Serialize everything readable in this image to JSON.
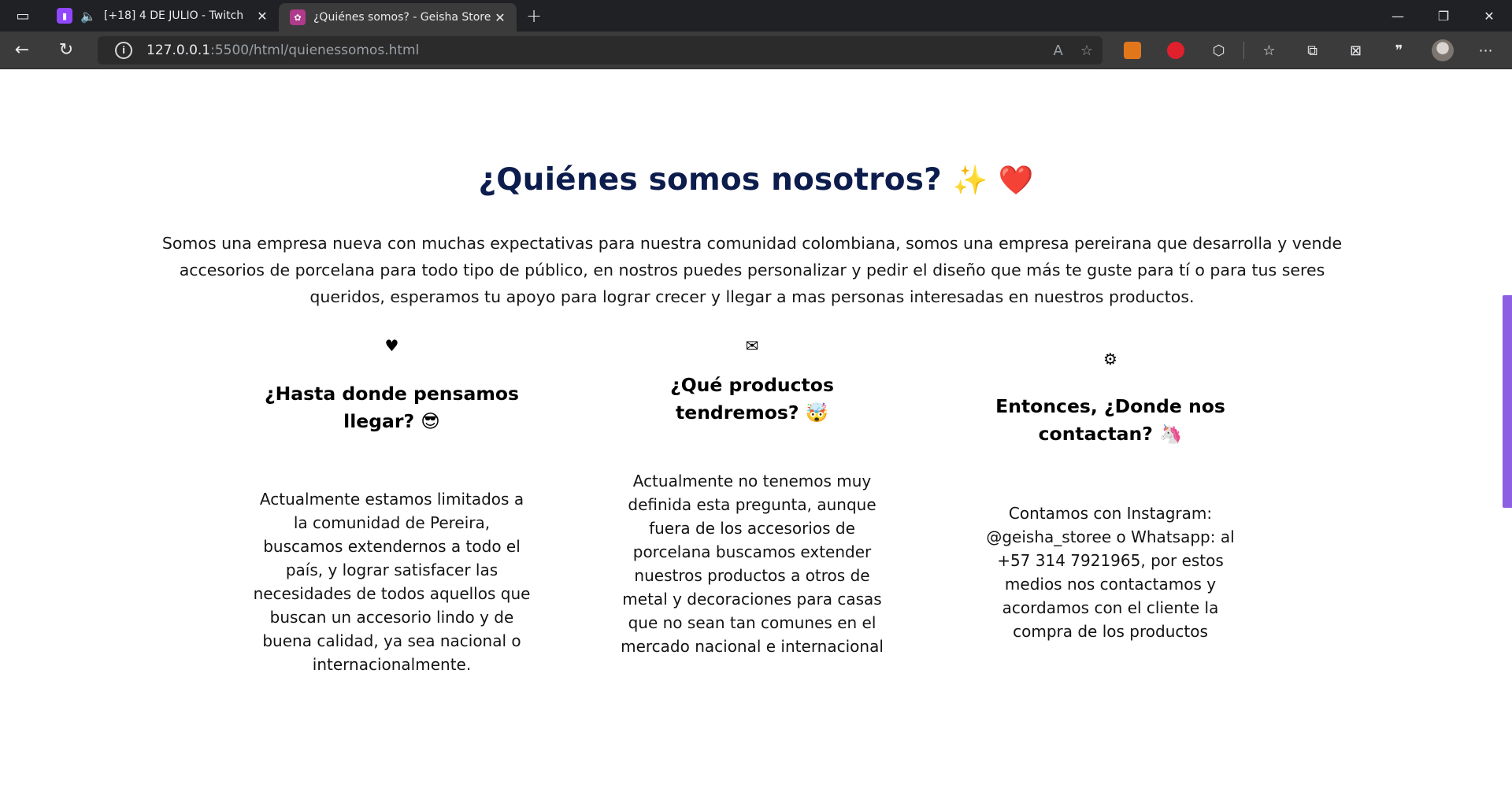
{
  "browser": {
    "tabs": [
      {
        "title": "[+18] 4 DE JULIO - Twitch",
        "active": false,
        "favicon": "twitch-icon",
        "audio": true
      },
      {
        "title": "¿Quiénes somos? - Geisha Store",
        "active": true,
        "favicon": "geisha-icon",
        "audio": false
      }
    ],
    "url_host": "127.0.0.1",
    "url_path": ":5500/html/quienessomos.html"
  },
  "page": {
    "heading": "¿Quiénes somos nosotros?",
    "heading_emojis": "✨ ❤️",
    "intro": "Somos una empresa nueva con muchas expectativas para nuestra comunidad colombiana, somos una empresa pereirana que desarrolla y vende accesorios de porcelana para todo tipo de público, en nostros puedes personalizar y pedir el diseño que más te guste para tí o para tus seres queridos, esperamos tu apoyo para lograr crecer y llegar a mas personas interesadas en nuestros productos.",
    "columns": [
      {
        "icon": "heart-icon",
        "icon_glyph": "♥",
        "title": "¿Hasta donde pensamos llegar? 😎",
        "text": "Actualmente estamos limitados a la comunidad de Pereira, buscamos extendernos a todo el país, y lograr satisfacer las necesidades de todos aquellos que buscan un accesorio lindo y de buena calidad, ya sea nacional o internacionalmente."
      },
      {
        "icon": "envelope-icon",
        "icon_glyph": "✉",
        "title": "¿Qué productos tendremos? 🤯",
        "text": "Actualmente no tenemos muy definida esta pregunta, aunque fuera de los accesorios de porcelana buscamos extender nuestros productos a otros de metal y decoraciones para casas que no sean tan comunes en el mercado nacional e internacional"
      },
      {
        "icon": "gear-icon",
        "icon_glyph": "⚙",
        "title": "Entonces, ¿Donde nos contactan? 🦄",
        "text": "Contamos con Instagram: @geisha_storee o Whatsapp: al +57 314 7921965, por estos medios nos contactamos y acordamos con el cliente la compra de los productos"
      }
    ]
  },
  "colors": {
    "heading": "#0c1c4d",
    "scrollbar": "#8d5fe3",
    "chrome_dark": "#202124",
    "chrome_toolbar": "#3b3b3b"
  }
}
